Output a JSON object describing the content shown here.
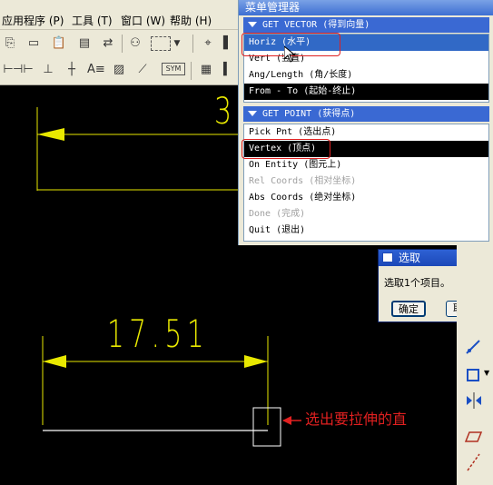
{
  "menubar": {
    "items": [
      "应用程序 (P)",
      "工具 (T)",
      "窗口 (W)",
      "帮助 (H)"
    ]
  },
  "menu_manager": {
    "title": "菜单管理器",
    "get_vector": {
      "header": "GET VECTOR (得到向量)",
      "options": [
        "Horiz (水平)",
        "Vert (竖直)",
        "Ang/Length (角/长度)",
        "From - To (起始-终止)"
      ]
    },
    "get_point": {
      "header": "GET POINT (获得点)",
      "options": [
        "Pick Pnt (选出点)",
        "Vertex (顶点)",
        "On Entity (图元上)",
        "Rel Coords (相对坐标)",
        "Abs Coords (绝对坐标)",
        "Done (完成)",
        "Quit (退出)"
      ]
    }
  },
  "select_dialog": {
    "title": "选取",
    "message": "选取1个项目。",
    "ok_label": "确定",
    "cancel_label": "取消"
  },
  "canvas": {
    "dimension_top": "3",
    "dimension_value": "17.51",
    "annotation": "选出要拉伸的直"
  },
  "colors": {
    "cad_line": "#e8e800",
    "annotation_red": "#e02020",
    "selection_blue": "#3169c6"
  },
  "icons": {
    "close": "close-icon",
    "dropdown": "triangle-down-icon"
  }
}
